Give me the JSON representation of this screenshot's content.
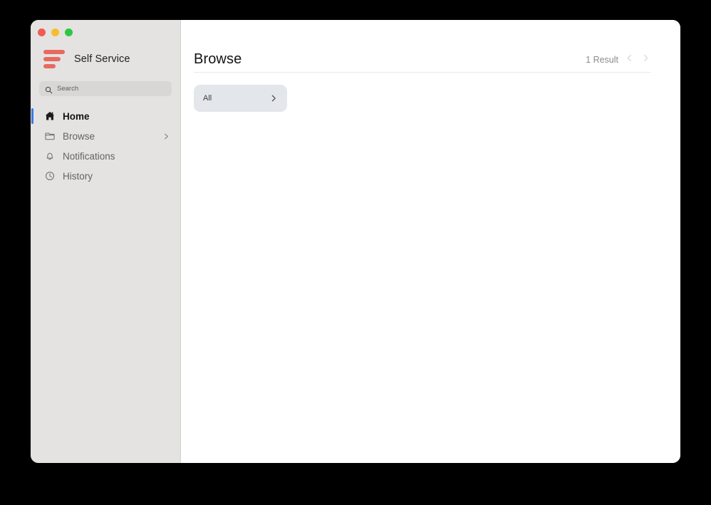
{
  "window": {
    "traffic_lights": [
      {
        "name": "close",
        "color": "#f15b51"
      },
      {
        "name": "minimize",
        "color": "#f7bd2e"
      },
      {
        "name": "maximize",
        "color": "#2dc840"
      }
    ]
  },
  "sidebar": {
    "brand": {
      "title": "Self Service",
      "logo_icon": "three-bars-logo-icon",
      "logo_color": "#e8695f"
    },
    "search": {
      "placeholder": "Search",
      "value": "",
      "icon": "search-icon"
    },
    "items": [
      {
        "label": "Home",
        "icon": "house-icon",
        "active": true,
        "has_chevron": false
      },
      {
        "label": "Browse",
        "icon": "folder-icon",
        "active": false,
        "has_chevron": true
      },
      {
        "label": "Notifications",
        "icon": "bell-icon",
        "active": false,
        "has_chevron": false
      },
      {
        "label": "History",
        "icon": "clock-icon",
        "active": false,
        "has_chevron": false
      }
    ],
    "active_indicator_color": "#3b78e7"
  },
  "main": {
    "title": "Browse",
    "result_count": "1 Result",
    "pager": {
      "prev_icon": "chevron-left-icon",
      "next_icon": "chevron-right-icon",
      "prev_enabled": false,
      "next_enabled": false
    },
    "cards": [
      {
        "label": "All",
        "chevron_icon": "chevron-right-icon"
      }
    ]
  }
}
